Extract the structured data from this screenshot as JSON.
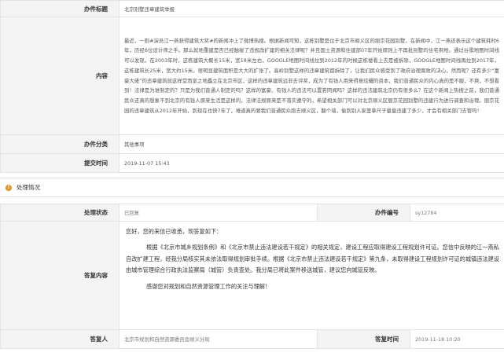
{
  "upper": {
    "title_label": "办件标题",
    "title_value": "北京别墅违章建筑举报",
    "content_label": "内容",
    "content_text": "最近，一则#演员江一燕获得建筑大奖#的新闻冲上了微博热搜。根据新闻可知，这栋别墅是位于北京市顺义区的丽京花园别墅，在新闻中，江一燕还表示这个建筑耗时6年，历经6位设计师之手。那么就地重建是否已经触碰了违规改扩建的相关法律呢？并且国土资源和住建部07年开始原则上不再批别墅的住宅用地。通过谷歌地图时间线可以发现，在2003年时，这栋建筑大概长15米，宽18米左右，GOOGLE地图时间线拉到2012年的时候这栋楼看上去是被拆除，GOOGLE地图时间线再拉到2017年，这栋建筑长25米，宽大约15米。很明显建筑面积是大大的扩张了。高岭别墅这样的违章建筑都拆除了，让我们民众感受到了政府治理腐败的决心，然而呢？还有多少“富豪大佬”的违章建筑就这样堂而皇之地矗立在北京市区，这样的违章建筑远非去评奖，成为了有钱人用来得意炫耀的资本，我们普通民众的内心真的是不服，不爽，不想看到！法律是为谁制定的？只是为我们普通人制定的吗？这样的富豪、有钱人的违法可以置若罔闻吗？这样的违法建筑北京仍有很多么？在这个新闻上热搜之前，我们普通民众还真的想象不到北京的有钱人原来生活是这样的，法律法规原来是不落实遵守的，希望相关部门可以对北京顺义区丽京花园别墅的违建行为进行调查和治理。丽京花园的违章建筑从2012年开始，到现在也快7年了，难道真的要我们普通民众跑去顺义区，翻个墙，偷到别人家里拿尺子量量违建了多少，才会有相关部门去管吗！",
    "category_label": "办件分类",
    "category_value": "其他事项",
    "submit_time_label": "提交时间",
    "submit_time_value": "2019-11-07 15:43"
  },
  "section": {
    "icon_name": "process-status-icon",
    "title": "处理情况"
  },
  "process": {
    "status_label": "处理状态",
    "status_value": "已回复",
    "case_no_label": "办件编号",
    "case_no_value": "sy12784",
    "reply_label": "答复内容",
    "reply_greeting": "您好，您的来信已收悉，现答复如下：",
    "reply_body": "根据《北京市城乡规划条例》和《北京市禁止违法建设若干规定》的相关规定，建设工程应取得建设工程规划许可证。您信中反映的江一燕私自改扩建工程，经我分局核实其未依法取得规划审批手续。根据《北京市禁止违法建设若干规定》第九条，未取得建设工程规划许可证的城镇违法建设由城市管理综合行政执法监察局（城管）负责查处。我分局已将此案件移送城管，建议您向城管反映。",
    "reply_thanks": "感谢您对规划和自然资源管理工作的关注与理解！",
    "responder_label": "答复人",
    "responder_value": "北京市规划和自然资源委员会顺义分局",
    "reply_time_label": "答复时间",
    "reply_time_value": "2019-11-18 10:20"
  }
}
